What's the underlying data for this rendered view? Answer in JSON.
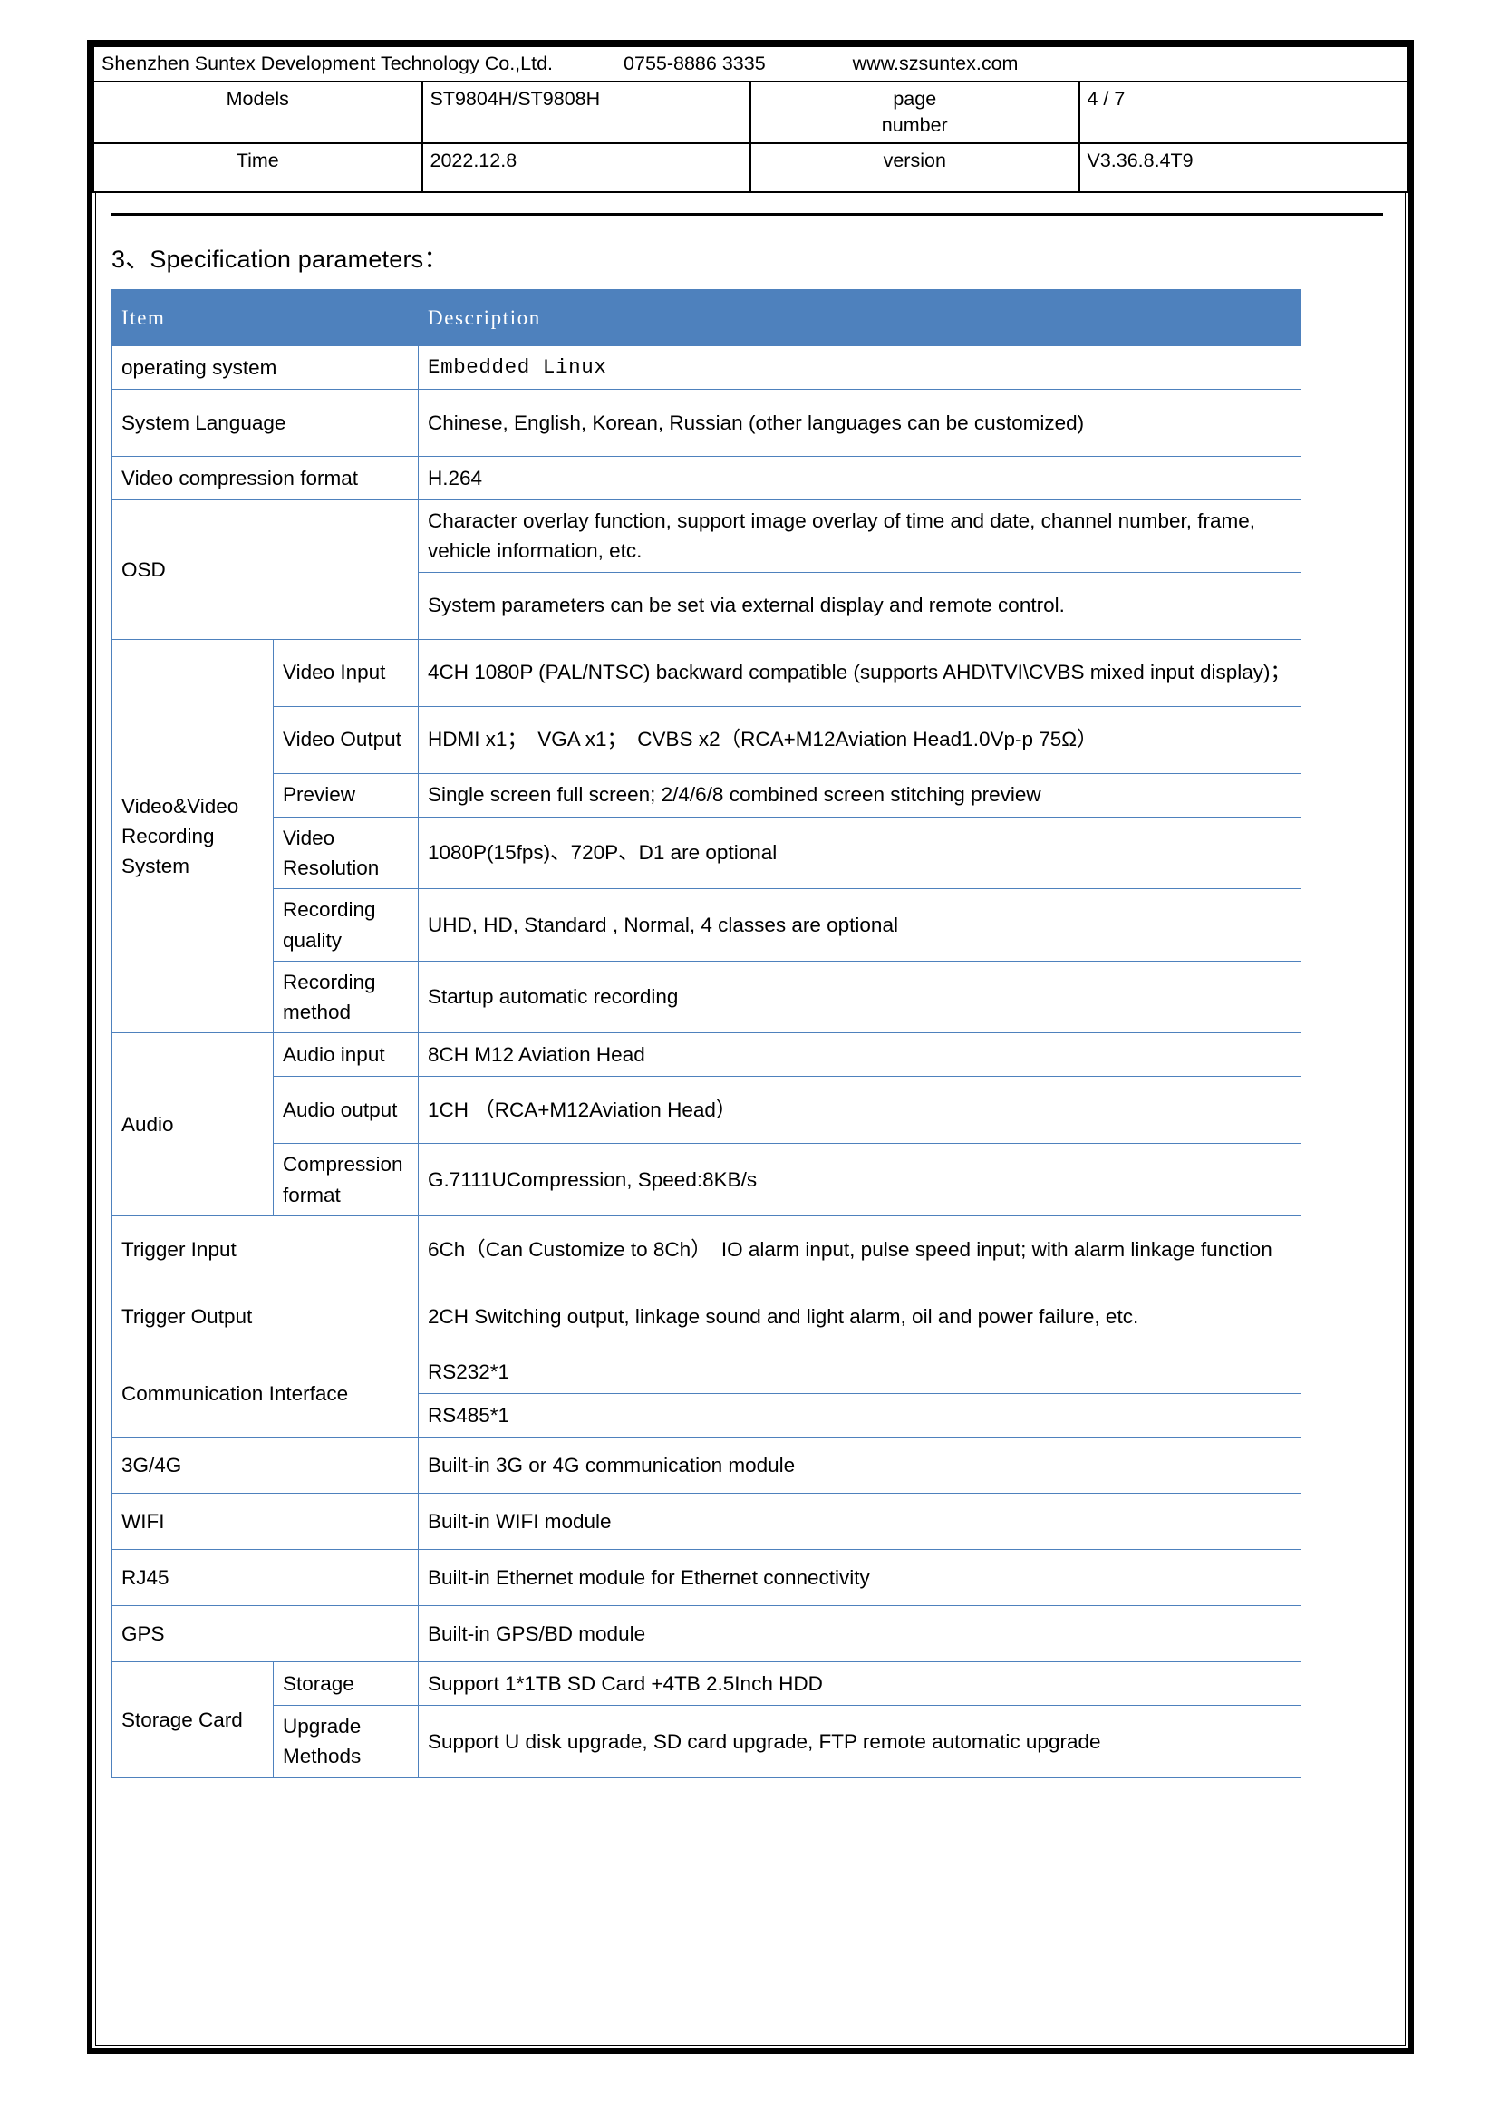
{
  "colors": {
    "accent_blue": "#4E81BD",
    "border_black": "#000000",
    "header_text": "#FFFFFF"
  },
  "header": {
    "company": "Shenzhen Suntex Development Technology Co.,Ltd.",
    "phone": "0755-8886 3335",
    "website": "www.szsuntex.com",
    "rows": [
      {
        "label": "Models",
        "value": "ST9804H/ST9808H",
        "mid_label": "page\nnumber",
        "mid_label_line1": "page",
        "mid_label_line2": "number",
        "last_value": "4 / 7"
      },
      {
        "label": "Time",
        "value": "2022.12.8",
        "mid_label": "version",
        "last_value": "V3.36.8.4T9"
      }
    ]
  },
  "section": {
    "number": "3、",
    "title": "Specification parameters：",
    "full": "3、Specification parameters："
  },
  "spec_table": {
    "columns": [
      "Item",
      "Description"
    ],
    "rows": [
      {
        "item": "operating system",
        "sub": null,
        "desc": "Embedded Linux",
        "desc_font": "mono"
      },
      {
        "item": "System Language",
        "sub": null,
        "desc": "Chinese, English, Korean, Russian (other languages can be customized)"
      },
      {
        "item": "Video compression format",
        "sub": null,
        "desc": "H.264"
      },
      {
        "item": "OSD",
        "sub": null,
        "desc": "Character overlay function, support image overlay of time and date, channel number, frame, vehicle information, etc."
      },
      {
        "item": "OSD",
        "sub": null,
        "desc": "System parameters can be set via external display and remote control."
      },
      {
        "item": "Video&Video Recording System",
        "sub": "Video Input",
        "desc": "4CH 1080P (PAL/NTSC) backward compatible (supports AHD\\TVI\\CVBS mixed input display)；"
      },
      {
        "item": "Video&Video Recording System",
        "sub": "Video Output",
        "desc": "HDMI x1；　VGA x1；　CVBS x2（RCA+M12Aviation Head1.0Vp-p 75Ω）"
      },
      {
        "item": "Video&Video Recording System",
        "sub": "Preview",
        "desc": "Single screen full screen; 2/4/6/8 combined screen stitching preview"
      },
      {
        "item": "Video&Video Recording System",
        "sub": "Video Resolution",
        "desc": "1080P(15fps)、720P、D1 are optional"
      },
      {
        "item": "Video&Video Recording System",
        "sub": "Recording quality",
        "desc": "UHD, HD, Standard , Normal, 4 classes are optional"
      },
      {
        "item": "Video&Video Recording System",
        "sub": "Recording method",
        "desc": "Startup automatic recording"
      },
      {
        "item": "Audio",
        "sub": "Audio input",
        "desc": "8CH M12 Aviation Head"
      },
      {
        "item": "Audio",
        "sub": "Audio output",
        "desc": "1CH （RCA+M12Aviation Head）"
      },
      {
        "item": "Audio",
        "sub": "Compression format",
        "desc": "G.7111UCompression, Speed:8KB/s"
      },
      {
        "item": "Trigger Input",
        "sub": null,
        "desc": "6Ch（Can Customize to 8Ch）　IO alarm input, pulse speed input; with alarm linkage function"
      },
      {
        "item": "Trigger Output",
        "sub": null,
        "desc": "2CH Switching output, linkage sound and light alarm, oil and power failure, etc."
      },
      {
        "item": "Communication Interface",
        "sub": null,
        "desc": "RS232*1"
      },
      {
        "item": "Communication Interface",
        "sub": null,
        "desc": "RS485*1"
      },
      {
        "item": "3G/4G",
        "sub": null,
        "desc": "Built-in 3G or 4G communication module"
      },
      {
        "item": "WIFI",
        "sub": null,
        "desc": "Built-in WIFI module"
      },
      {
        "item": "RJ45",
        "sub": null,
        "desc": "Built-in Ethernet module for Ethernet connectivity"
      },
      {
        "item": "GPS",
        "sub": null,
        "desc": "Built-in GPS/BD module"
      },
      {
        "item": "Storage Card",
        "sub": "Storage",
        "desc": "Support 1*1TB SD Card +4TB 2.5Inch HDD"
      },
      {
        "item": "Storage Card",
        "sub": "Upgrade Methods",
        "desc": "Support U disk upgrade, SD card upgrade, FTP remote automatic upgrade"
      }
    ],
    "groups": {
      "video_system": "Video&Video Recording System",
      "audio": "Audio",
      "storage_card": "Storage Card",
      "osd": "OSD",
      "communication": "Communication Interface",
      "trigger_input": "Trigger Input",
      "trigger_output": "Trigger Output",
      "g3g4g": "3G/4G",
      "wifi": "WIFI",
      "rj45": "RJ45",
      "gps": "GPS"
    },
    "sub_labels": {
      "video_input": "Video Input",
      "video_output": "Video Output",
      "preview": "Preview",
      "video_resolution": "Video Resolution",
      "recording_quality": "Recording quality",
      "recording_method": "Recording method",
      "audio_input": "Audio input",
      "audio_output": "Audio output",
      "compression_format": "Compression format",
      "storage": "Storage",
      "upgrade_methods": "Upgrade Methods"
    },
    "descriptions": {
      "operating_system": "Embedded Linux",
      "system_language": "Chinese, English, Korean, Russian (other languages can be customized)",
      "video_compression": "H.264",
      "osd_1": "Character overlay function, support image overlay of time and date, channel number, frame, vehicle information, etc.",
      "osd_2": "System parameters can be set via external display and remote control.",
      "video_input": "4CH 1080P (PAL/NTSC) backward compatible (supports AHD\\TVI\\CVBS mixed input display)；",
      "video_output": "HDMI x1；　VGA x1；　CVBS x2（RCA+M12Aviation Head1.0Vp-p 75Ω）",
      "preview": "Single screen full screen; 2/4/6/8 combined screen stitching preview",
      "video_resolution": "1080P(15fps)、720P、D1 are optional",
      "recording_quality": "UHD, HD, Standard , Normal, 4 classes are optional",
      "recording_method": "Startup automatic recording",
      "audio_input": "8CH M12 Aviation Head",
      "audio_output": "1CH （RCA+M12Aviation Head）",
      "compression_format": "G.7111UCompression, Speed:8KB/s",
      "trigger_input": "6Ch（Can Customize to 8Ch）　IO alarm input, pulse speed input; with alarm linkage function",
      "trigger_output": "2CH Switching output, linkage sound and light alarm, oil and power failure, etc.",
      "rs232": "RS232*1",
      "rs485": "RS485*1",
      "g3g4g": "Built-in 3G or 4G communication module",
      "wifi": "Built-in WIFI module",
      "rj45": "Built-in Ethernet module for Ethernet connectivity",
      "gps": "Built-in GPS/BD module",
      "storage": "Support 1*1TB SD Card +4TB 2.5Inch HDD",
      "upgrade_methods": "Support U disk upgrade, SD card upgrade, FTP remote automatic upgrade"
    },
    "item_labels": {
      "operating_system": "operating system",
      "system_language": "System Language",
      "video_compression": "Video compression format"
    }
  }
}
